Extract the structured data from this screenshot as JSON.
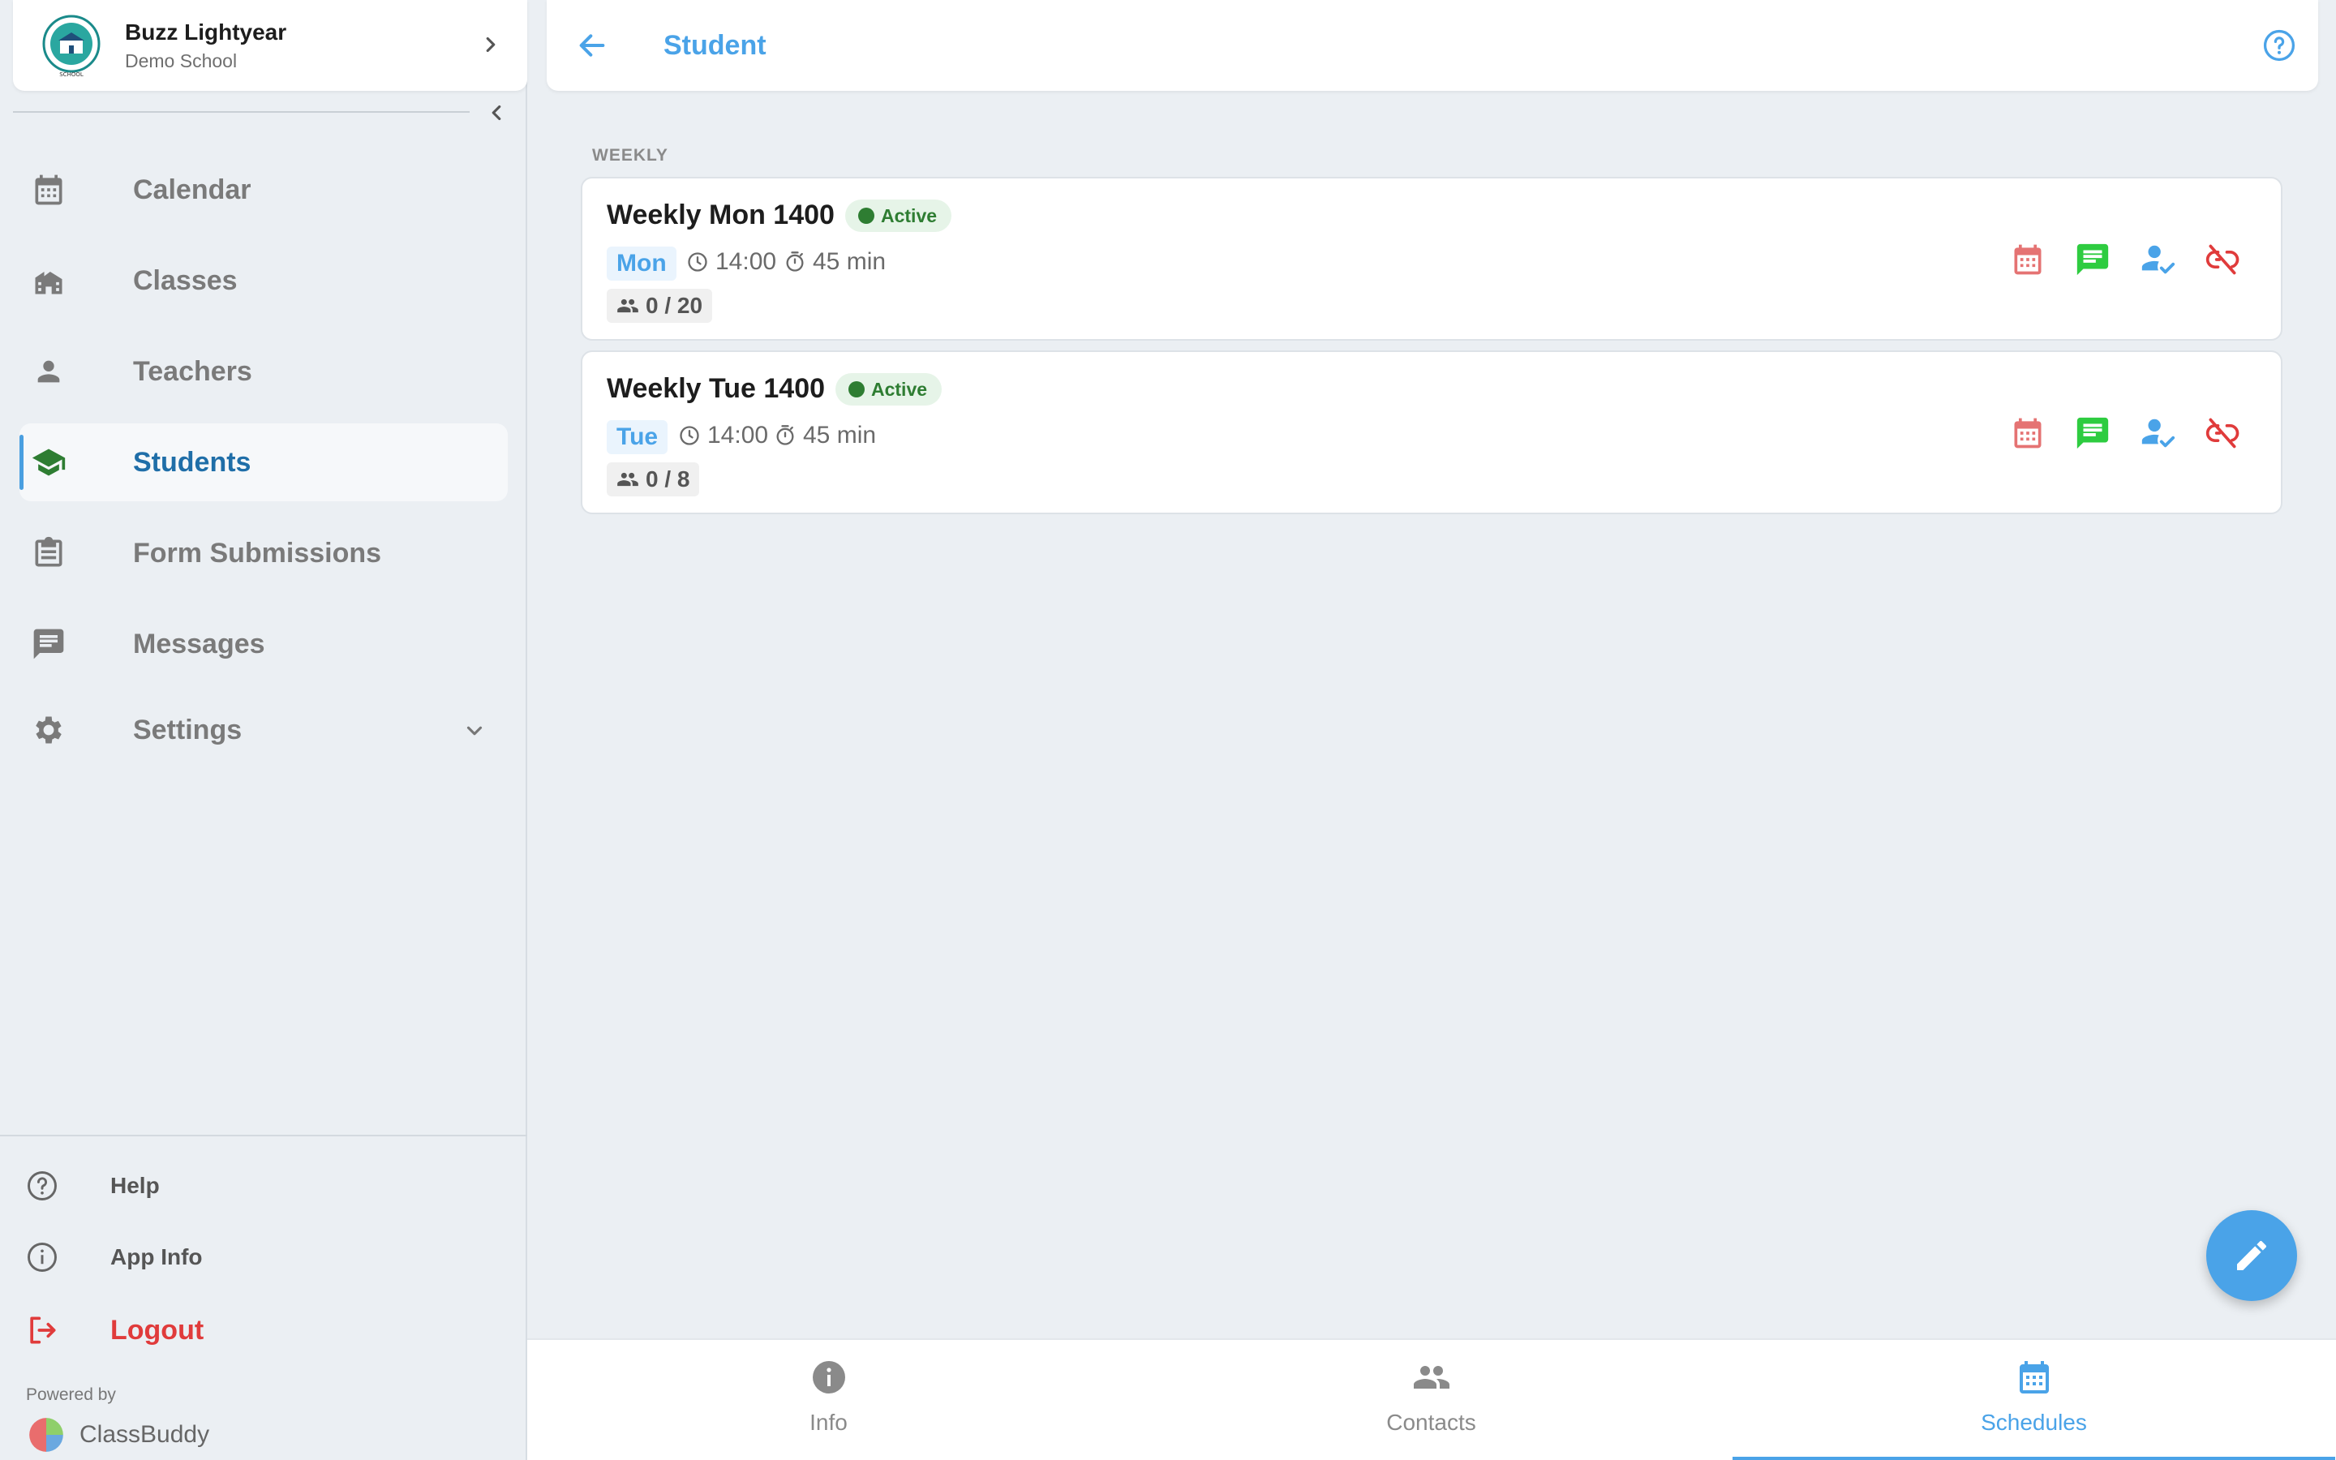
{
  "account": {
    "name": "Buzz Lightyear",
    "school": "Demo School"
  },
  "nav": [
    {
      "label": "Calendar",
      "icon": "calendar-icon"
    },
    {
      "label": "Classes",
      "icon": "school-building-icon"
    },
    {
      "label": "Teachers",
      "icon": "person-icon"
    },
    {
      "label": "Students",
      "icon": "graduation-cap-icon",
      "active": true
    },
    {
      "label": "Form Submissions",
      "icon": "clipboard-icon"
    },
    {
      "label": "Messages",
      "icon": "message-icon"
    },
    {
      "label": "Settings",
      "icon": "gear-icon"
    }
  ],
  "bottom_nav": {
    "help": "Help",
    "app_info": "App Info",
    "logout": "Logout"
  },
  "powered_by": {
    "label": "Powered by",
    "brand": "ClassBuddy"
  },
  "header": {
    "title": "Student"
  },
  "section_label": "WEEKLY",
  "schedules": [
    {
      "title": "Weekly Mon 1400",
      "status": "Active",
      "day": "Mon",
      "time": "14:00",
      "duration": "45 min",
      "capacity": "0 / 20"
    },
    {
      "title": "Weekly Tue 1400",
      "status": "Active",
      "day": "Tue",
      "time": "14:00",
      "duration": "45 min",
      "capacity": "0 / 8"
    }
  ],
  "tabs": [
    {
      "label": "Info",
      "icon": "info-icon"
    },
    {
      "label": "Contacts",
      "icon": "people-icon"
    },
    {
      "label": "Schedules",
      "icon": "calendar-icon",
      "active": true
    }
  ],
  "colors": {
    "accent": "#4aa3e8",
    "active_status": "#2e7d32",
    "danger": "#e03b3b",
    "calendar_action": "#e57373",
    "message_action": "#2ecc40"
  }
}
